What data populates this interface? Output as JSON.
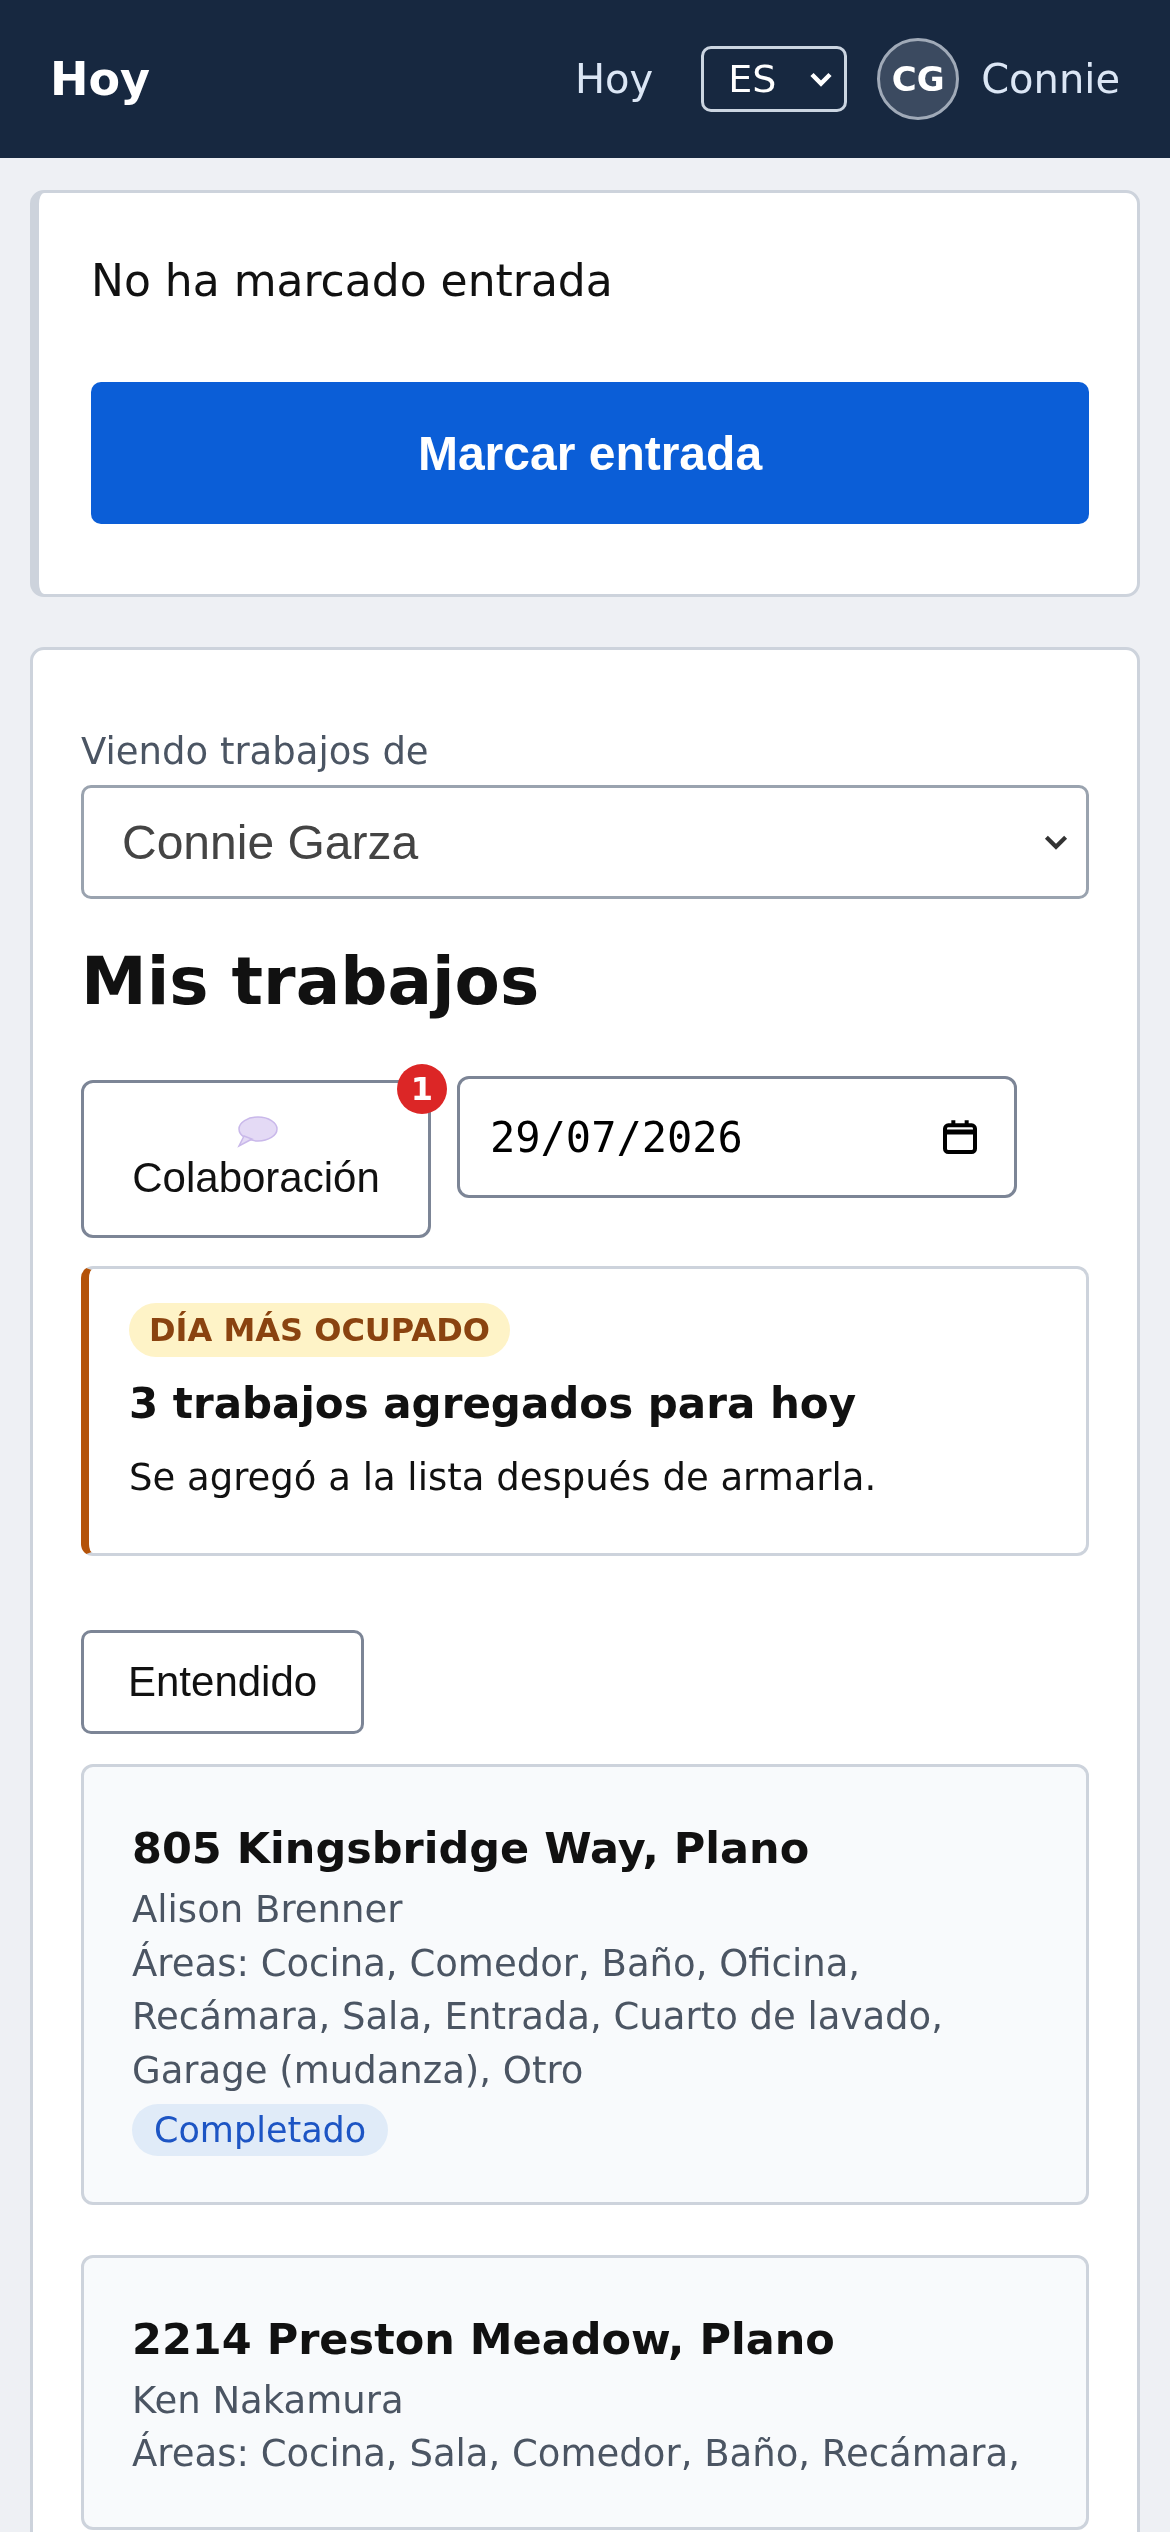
{
  "header": {
    "title": "Hoy",
    "nav_link": "Hoy",
    "language": "ES",
    "user_initials": "CG",
    "user_name": "Connie"
  },
  "clock": {
    "status": "No ha marcado entrada",
    "button": "Marcar entrada"
  },
  "jobs": {
    "viewer_label": "Viendo trabajos de",
    "viewer_value": "Connie Garza",
    "heading": "Mis trabajos",
    "collab_button": {
      "label": "Colaboración",
      "badge": "1"
    },
    "date": "29/07/2026",
    "alert": {
      "tag": "DÍA MÁS OCUPADO",
      "title": "3 trabajos agregados para hoy",
      "message": "Se agregó a la lista después de armarla."
    },
    "ack_button": "Entendido",
    "items": [
      {
        "address": "805 Kingsbridge Way, Plano",
        "customer": "Alison Brenner",
        "areas": "Áreas: Cocina, Comedor, Baño, Oficina, Recámara, Sala, Entrada, Cuarto de lavado, Garage (mudanza), Otro",
        "status": {
          "label": "Completado",
          "kind": "completed"
        }
      },
      {
        "address": "2214 Preston Meadow, Plano",
        "customer": "Ken Nakamura",
        "areas": "Áreas: Cocina, Sala, Comedor, Baño, Recámara,"
      }
    ]
  }
}
